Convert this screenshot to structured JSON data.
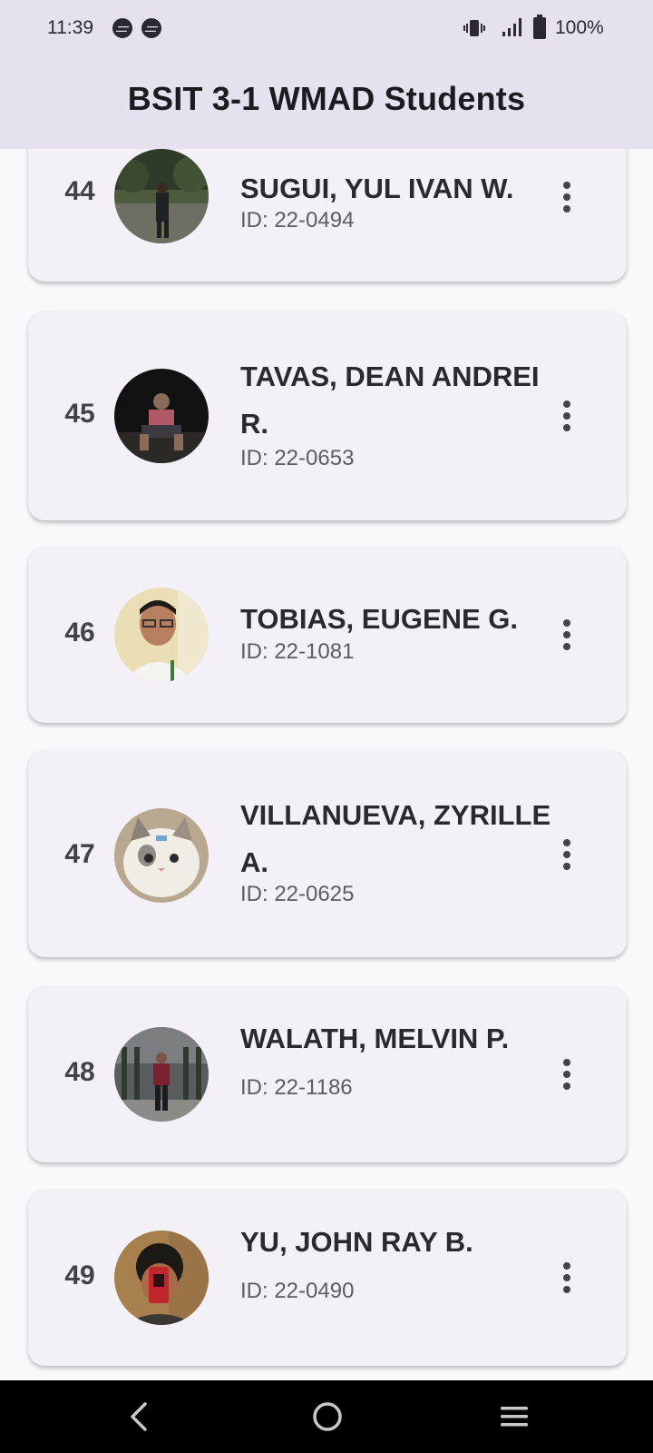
{
  "status_bar": {
    "time": "11:39",
    "battery": "100%"
  },
  "app_bar": {
    "title": "BSIT 3-1 WMAD Students"
  },
  "students": [
    {
      "number": "44",
      "name": "SUGUI, YUL IVAN W.",
      "id_text": "ID: 22-0494",
      "avatar": "photo-outdoor-trees"
    },
    {
      "number": "45",
      "name": "TAVAS, DEAN ANDREI R.",
      "id_text": "ID: 22-0653",
      "avatar": "photo-night"
    },
    {
      "number": "46",
      "name": "TOBIAS, EUGENE G.",
      "id_text": "ID: 22-1081",
      "avatar": "photo-portrait-glasses"
    },
    {
      "number": "47",
      "name": "VILLANUEVA, ZYRILLE A.",
      "id_text": "ID: 22-0625",
      "avatar": "photo-white-kitten"
    },
    {
      "number": "48",
      "name": "WALATH, MELVIN P.",
      "id_text": "ID: 22-1186",
      "avatar": "photo-standing-figure"
    },
    {
      "number": "49",
      "name": "YU, JOHN RAY B.",
      "id_text": "ID: 22-0490",
      "avatar": "photo-phone-selfie"
    }
  ],
  "icons": {
    "status": [
      "messenger-icon",
      "messenger-icon",
      "vibrate-icon",
      "signal-icon",
      "battery-icon"
    ],
    "row_action": "more-vert-icon",
    "nav": [
      "back-icon",
      "home-icon",
      "recents-icon"
    ]
  },
  "colors": {
    "app_bar": "#e7e1ef",
    "card": "#f4f0f7",
    "background": "#fbf7fd",
    "nav_bar": "#000000"
  }
}
